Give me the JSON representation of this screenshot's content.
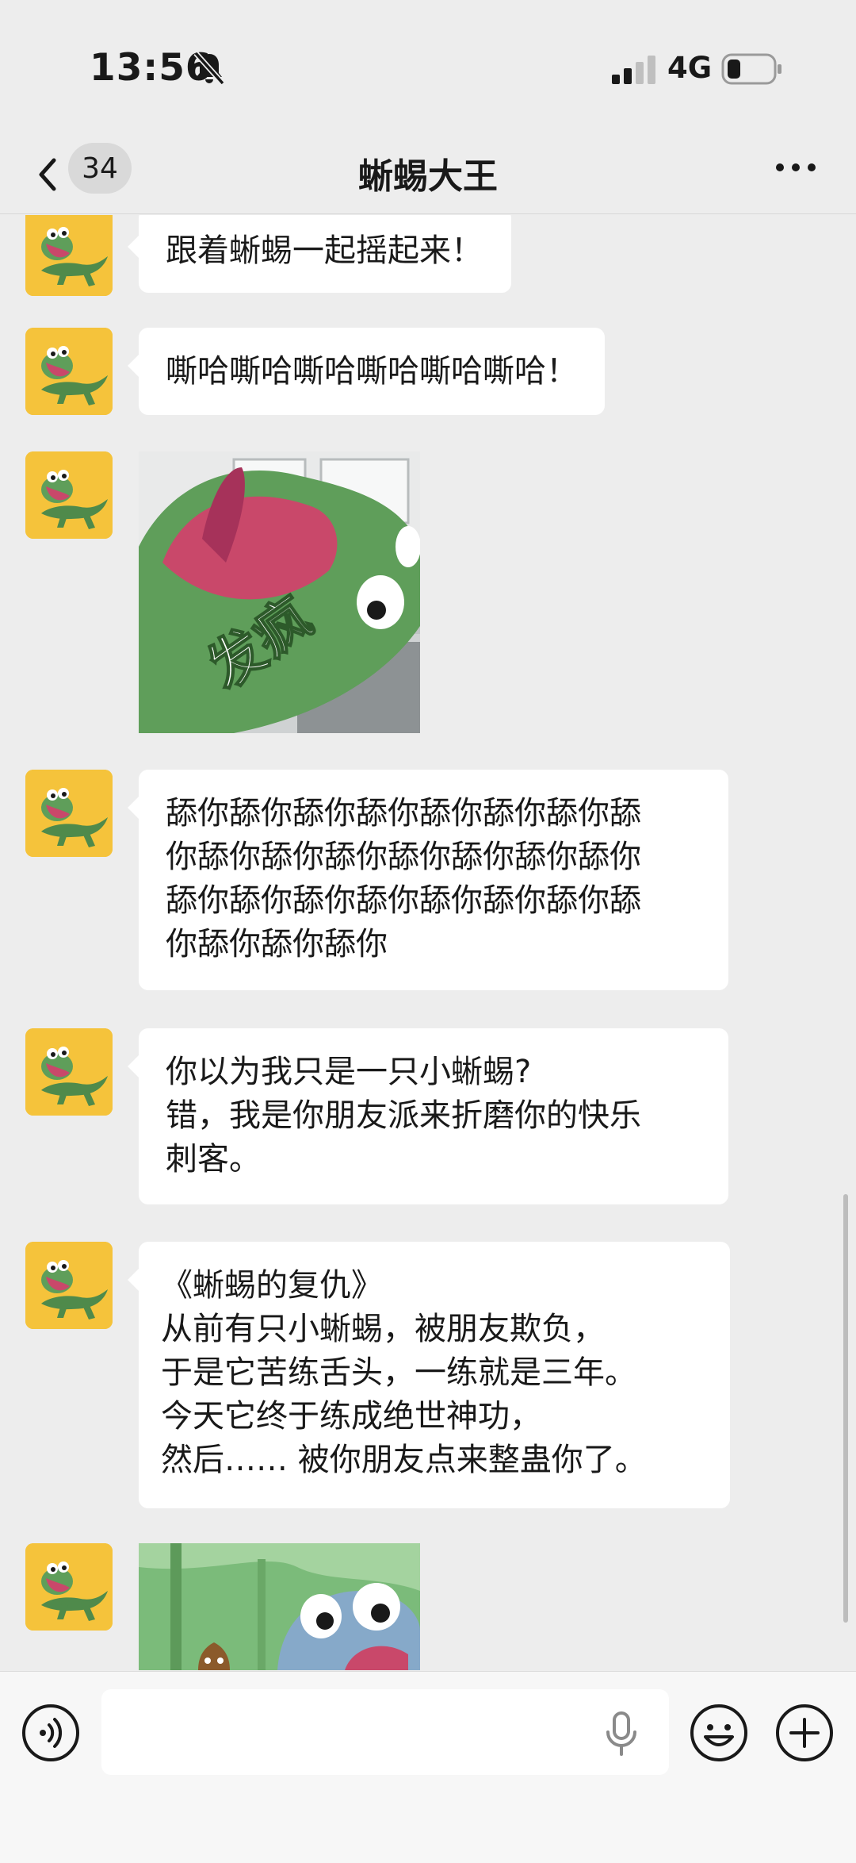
{
  "status_bar": {
    "time": "13:56",
    "network": "4G",
    "icons": [
      "bell-off-icon",
      "signal-icon",
      "battery-icon"
    ]
  },
  "header": {
    "back_icon": "chevron-left-icon",
    "unread_count": "34",
    "title": "蜥蜴大王",
    "more_icon": "more-dots-icon"
  },
  "messages": [
    {
      "type": "text",
      "text": "跟着蜥蜴一起摇起来！"
    },
    {
      "type": "text",
      "text": "嘶哈嘶哈嘶哈嘶哈嘶哈嘶哈！"
    },
    {
      "type": "sticker",
      "caption": "发疯"
    },
    {
      "type": "text",
      "text": "舔你舔你舔你舔你舔你舔你舔你舔\n你舔你舔你舔你舔你舔你舔你舔你\n舔你舔你舔你舔你舔你舔你舔你舔\n你舔你舔你舔你"
    },
    {
      "type": "text",
      "text": "你以为我只是一只小蜥蜴?\n错，我是你朋友派来折磨你的快乐\n刺客。"
    },
    {
      "type": "text",
      "text": "《蜥蜴的复仇》\n从前有只小蜥蜴，被朋友欺负，\n于是它苦练舌头，一练就是三年。\n今天它终于练成绝世神功，\n然后…… 被你朋友点来整蛊你了。"
    },
    {
      "type": "sticker",
      "caption": ""
    }
  ],
  "input_bar": {
    "voice_icon": "voice-icon",
    "input_value": "",
    "mic_icon": "mic-icon",
    "emoji_icon": "emoji-icon",
    "plus_icon": "plus-icon"
  },
  "colors": {
    "background": "#ededed",
    "bubble": "#ffffff",
    "avatar_bg": "#f5c33b",
    "lizard_green": "#5f9e5a"
  }
}
